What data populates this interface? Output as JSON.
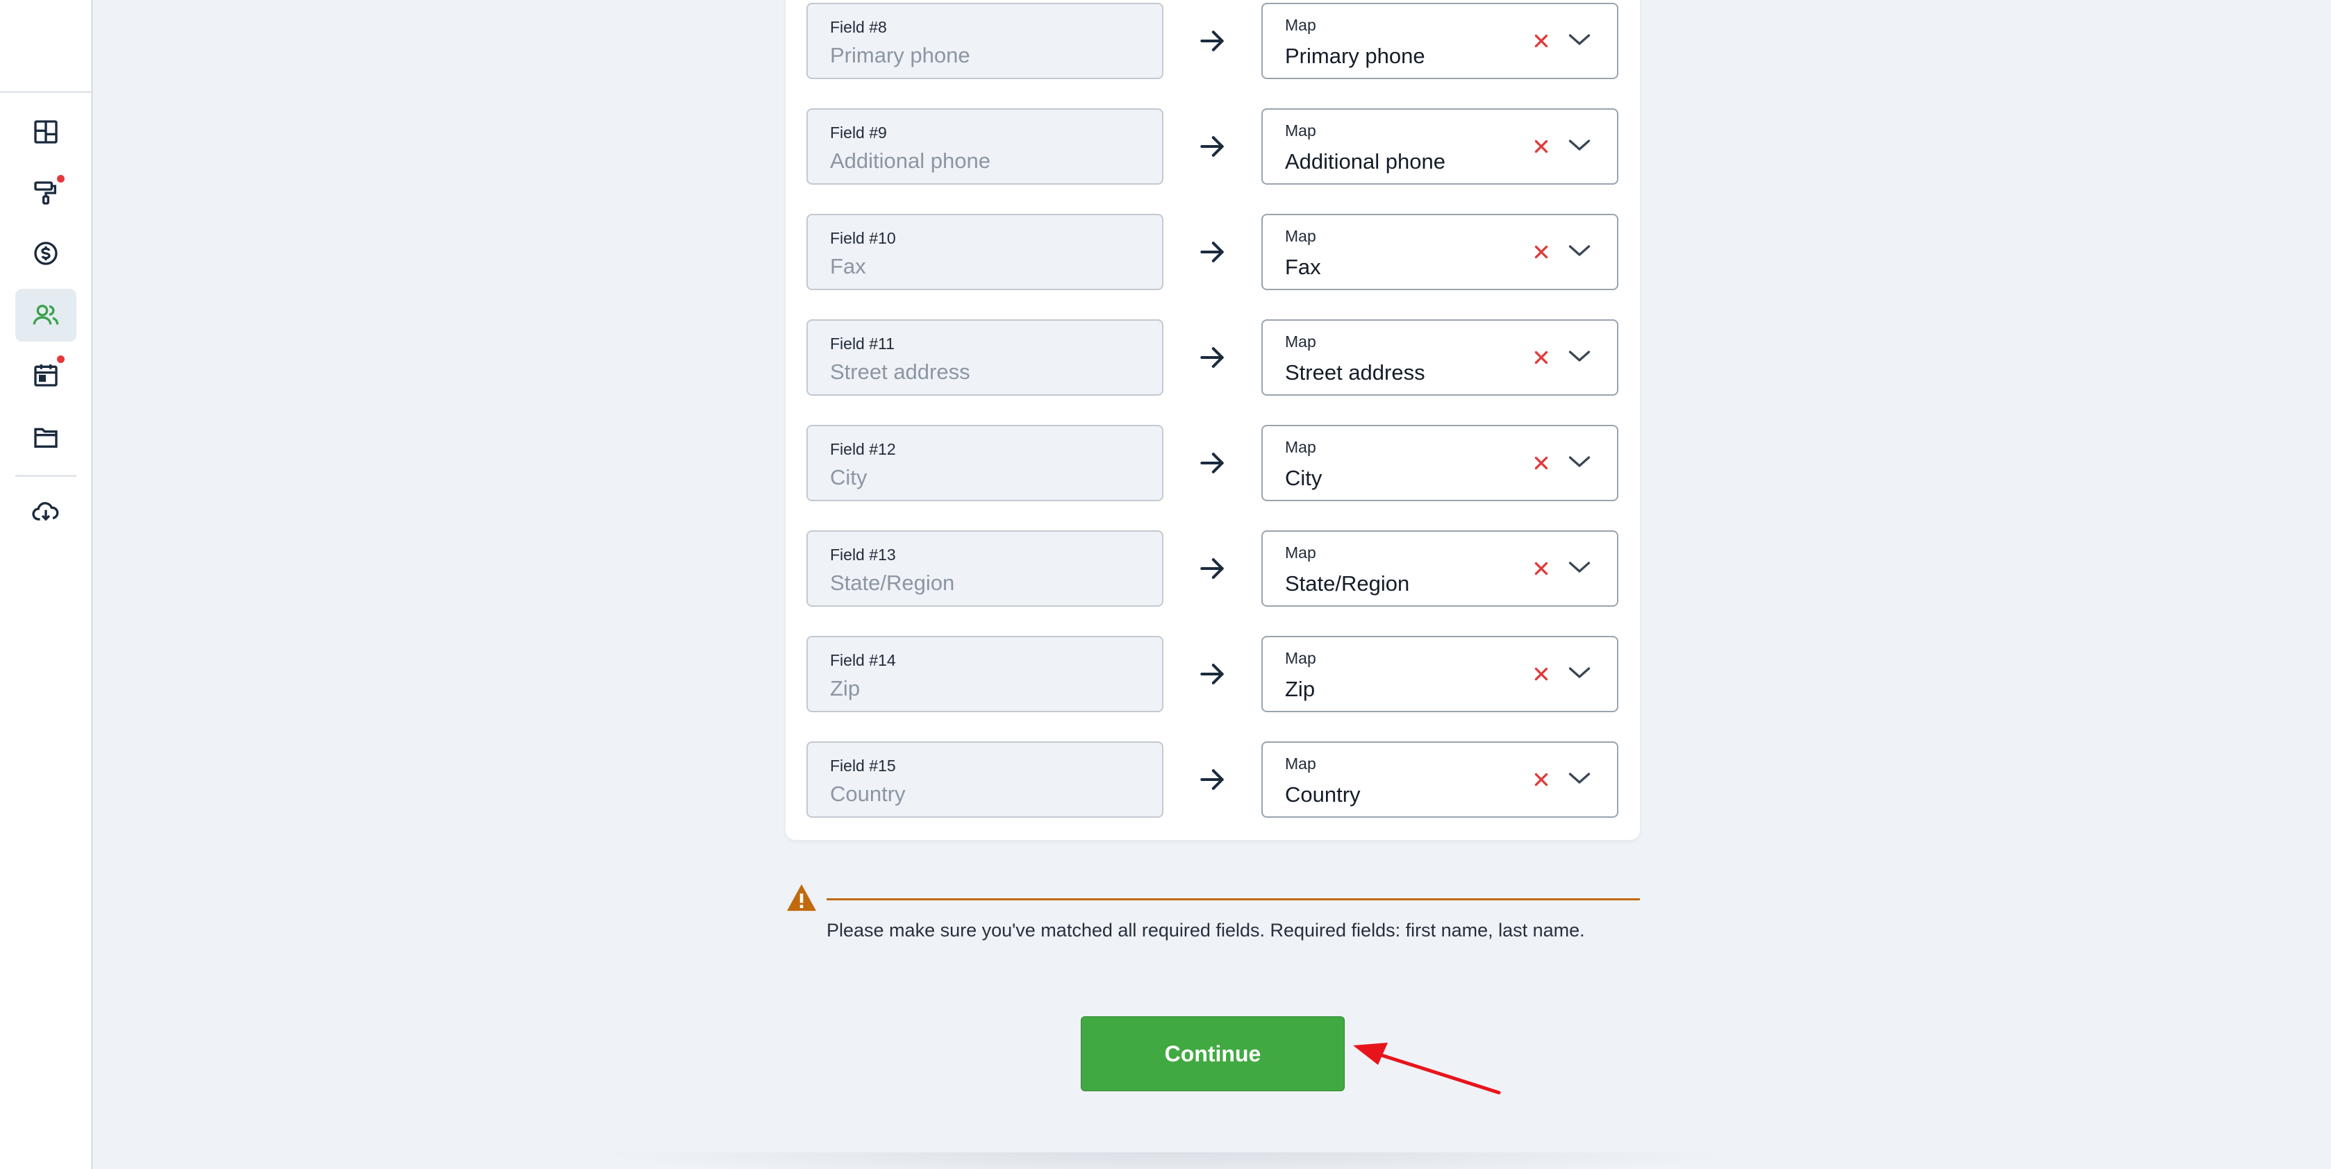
{
  "sidebar": {
    "items": [
      {
        "icon": "dashboard-icon"
      },
      {
        "icon": "paint-roller-icon",
        "badge": true
      },
      {
        "icon": "dollar-icon"
      },
      {
        "icon": "users-icon",
        "active": true
      },
      {
        "icon": "calendar-icon",
        "badge": true
      },
      {
        "icon": "folder-icon"
      },
      {
        "icon": "cloud-download-icon"
      }
    ]
  },
  "mapping": {
    "rows": [
      {
        "field_label": "Field #8",
        "field_value": "Primary phone",
        "map_label": "Map",
        "map_value": "Primary phone"
      },
      {
        "field_label": "Field #9",
        "field_value": "Additional phone",
        "map_label": "Map",
        "map_value": "Additional phone"
      },
      {
        "field_label": "Field #10",
        "field_value": "Fax",
        "map_label": "Map",
        "map_value": "Fax"
      },
      {
        "field_label": "Field #11",
        "field_value": "Street address",
        "map_label": "Map",
        "map_value": "Street address"
      },
      {
        "field_label": "Field #12",
        "field_value": "City",
        "map_label": "Map",
        "map_value": "City"
      },
      {
        "field_label": "Field #13",
        "field_value": "State/Region",
        "map_label": "Map",
        "map_value": "State/Region"
      },
      {
        "field_label": "Field #14",
        "field_value": "Zip",
        "map_label": "Map",
        "map_value": "Zip"
      },
      {
        "field_label": "Field #15",
        "field_value": "Country",
        "map_label": "Map",
        "map_value": "Country"
      }
    ]
  },
  "warning": {
    "text": "Please make sure you've matched all required fields. Required fields: first name, last name."
  },
  "actions": {
    "continue_label": "Continue"
  },
  "colors": {
    "accent": "#41a942",
    "active_icon": "#3aa14b",
    "warning": "#c1690d",
    "clear": "#e03a3a",
    "badge": "#e5383b",
    "annotation_arrow": "#e8141c"
  }
}
